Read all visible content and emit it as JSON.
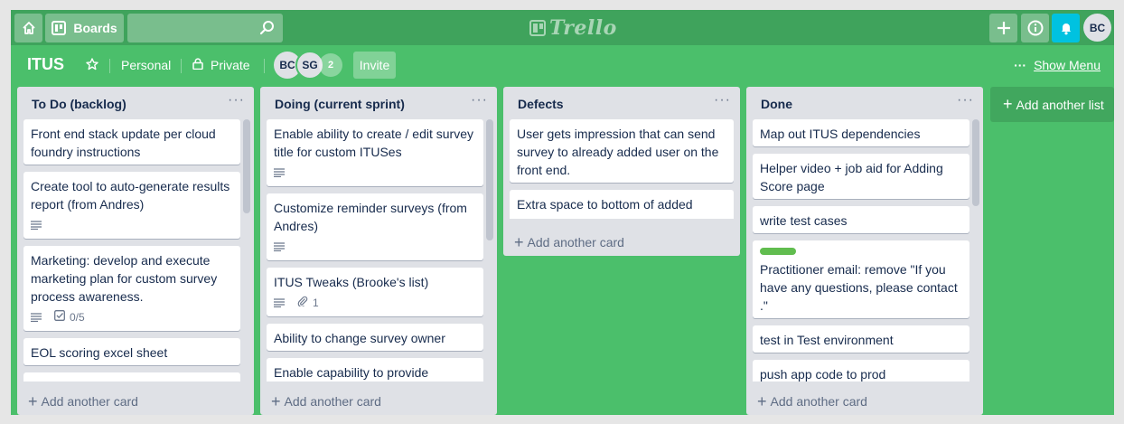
{
  "header": {
    "boards_label": "Boards",
    "search_value": "",
    "logo_text": "Trello",
    "user_initials": "BC"
  },
  "board": {
    "title": "ITUS",
    "team_label": "Personal",
    "visibility_label": "Private",
    "members": [
      "BC",
      "SG"
    ],
    "extra_members": "2",
    "invite_label": "Invite",
    "menu_dots": "···",
    "show_menu_label": "Show Menu"
  },
  "lists": [
    {
      "title": "To Do (backlog)",
      "cards": [
        {
          "text": "Front end stack update per cloud foundry instructions"
        },
        {
          "text": "Create tool to auto-generate results report (from Andres)",
          "description": true
        },
        {
          "text": "Marketing: develop and execute marketing plan for custom survey process awareness.",
          "description": true,
          "checklist": "0/5"
        },
        {
          "text": "EOL scoring excel sheet"
        },
        {
          "text": ""
        }
      ],
      "add_card_label": "Add another card"
    },
    {
      "title": "Doing (current sprint)",
      "cards": [
        {
          "text": "Enable ability to create / edit survey title for custom ITUSes",
          "description": true
        },
        {
          "text": "Customize reminder surveys (from Andres)",
          "description": true
        },
        {
          "text": "ITUS Tweaks (Brooke's list)",
          "description": true,
          "attachments": "1"
        },
        {
          "text": "Ability to change survey owner"
        },
        {
          "text": "Enable capability to provide"
        }
      ],
      "add_card_label": "Add another card"
    },
    {
      "title": "Defects",
      "cards": [
        {
          "text": "User gets impression that can send survey to already added user on the front end."
        },
        {
          "text": "Extra space to bottom of added scores"
        }
      ],
      "add_card_label": "Add another card"
    },
    {
      "title": "Done",
      "cards": [
        {
          "text": "Map out ITUS dependencies"
        },
        {
          "text": "Helper video + job aid for Adding Score page"
        },
        {
          "text": "write test cases"
        },
        {
          "text": "Practitioner email: remove \"If you have any questions, please contact .\"",
          "label_color": "#61bd4f"
        },
        {
          "text": "test in Test environment"
        },
        {
          "text": "push app code to prod"
        },
        {
          "text": ""
        }
      ],
      "add_card_label": "Add another card"
    }
  ],
  "add_list_label": "Add another list",
  "colors": {
    "board_bg": "#4bbf6b",
    "header_bg": "#3fa35c",
    "list_bg": "#dfe1e6",
    "notification_button": "#00c2e0",
    "label_green": "#61bd4f"
  }
}
